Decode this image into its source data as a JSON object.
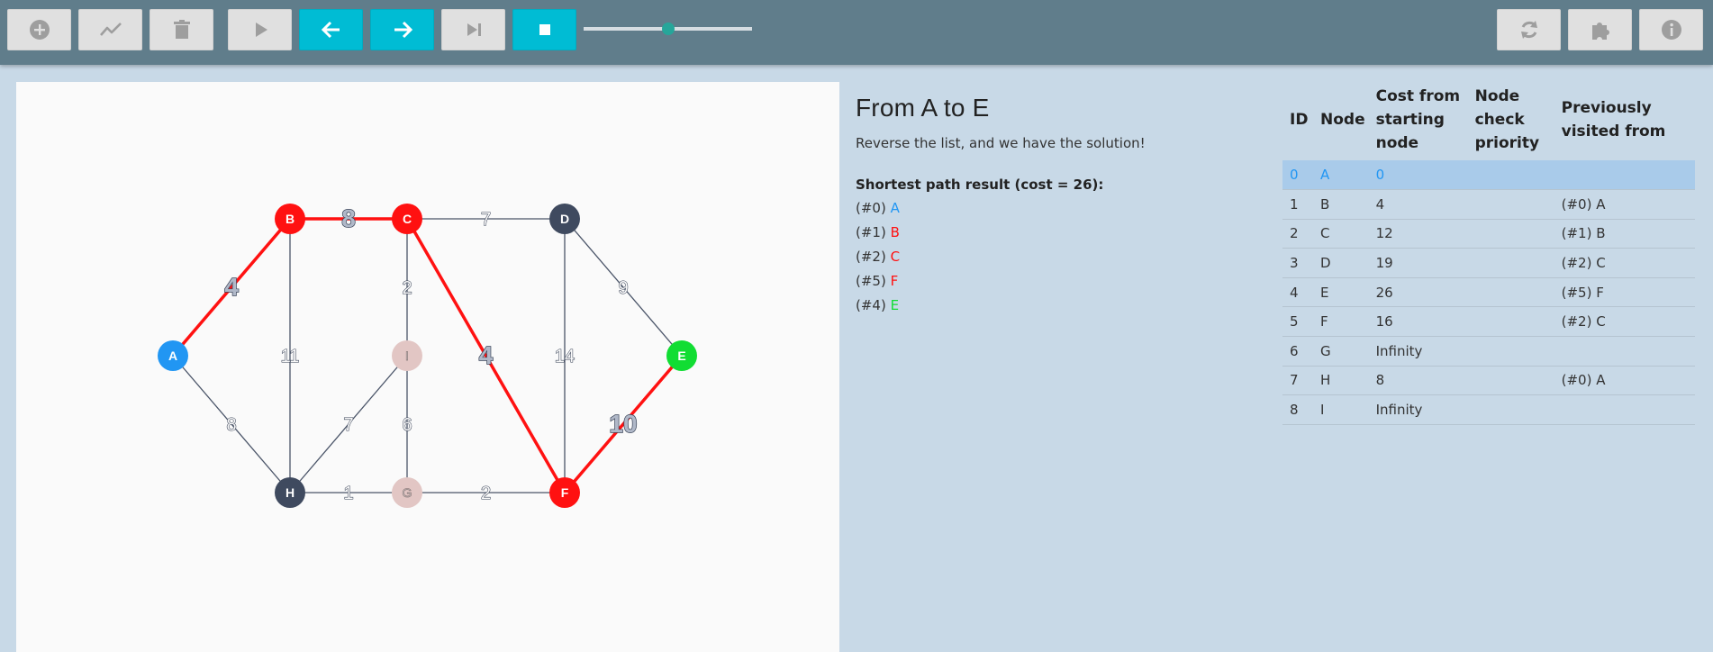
{
  "toolbar": {
    "left_buttons": [
      {
        "name": "add-node-button",
        "icon": "plus-circle-icon",
        "active": false
      },
      {
        "name": "add-edge-button",
        "icon": "chart-line-icon",
        "active": false
      },
      {
        "name": "delete-button",
        "icon": "trash-icon",
        "active": false
      },
      {
        "name": "play-button",
        "icon": "play-icon",
        "active": false
      },
      {
        "name": "step-back-button",
        "icon": "arrow-left-icon",
        "active": true
      },
      {
        "name": "step-forward-button",
        "icon": "arrow-right-icon",
        "active": true
      },
      {
        "name": "skip-to-end-button",
        "icon": "skip-end-icon",
        "active": false
      },
      {
        "name": "stop-button",
        "icon": "stop-icon",
        "active": true
      }
    ],
    "right_buttons": [
      {
        "name": "reset-button",
        "icon": "refresh-icon"
      },
      {
        "name": "plugin-button",
        "icon": "puzzle-icon"
      },
      {
        "name": "info-button",
        "icon": "info-icon"
      }
    ],
    "speed_slider": 0.5,
    "colors": {
      "bar": "#607d8b",
      "button": "#e0e0e0",
      "active": "#00bcd4",
      "thumb": "#26a69a"
    }
  },
  "graph": {
    "nodes": [
      {
        "id": "A",
        "state": "start",
        "color": "#2196f3"
      },
      {
        "id": "B",
        "state": "path",
        "color": "#ff1111"
      },
      {
        "id": "C",
        "state": "path",
        "color": "#ff1111"
      },
      {
        "id": "D",
        "state": "visited",
        "color": "#3f4a5f"
      },
      {
        "id": "E",
        "state": "end",
        "color": "#11dd33"
      },
      {
        "id": "F",
        "state": "path",
        "color": "#ff1111"
      },
      {
        "id": "G",
        "state": "unvisited",
        "color": "#e2c6c4"
      },
      {
        "id": "H",
        "state": "visited",
        "color": "#3f4a5f"
      },
      {
        "id": "I",
        "state": "unvisited",
        "color": "#e2c6c4"
      }
    ],
    "edges": [
      {
        "from": "A",
        "to": "B",
        "weight": "4",
        "on_path": true
      },
      {
        "from": "B",
        "to": "C",
        "weight": "8",
        "on_path": true
      },
      {
        "from": "C",
        "to": "D",
        "weight": "7",
        "on_path": false
      },
      {
        "from": "D",
        "to": "E",
        "weight": "9",
        "on_path": false
      },
      {
        "from": "B",
        "to": "H",
        "weight": "11",
        "on_path": false
      },
      {
        "from": "C",
        "to": "I",
        "weight": "2",
        "on_path": false
      },
      {
        "from": "C",
        "to": "F",
        "weight": "4",
        "on_path": true
      },
      {
        "from": "D",
        "to": "F",
        "weight": "14",
        "on_path": false
      },
      {
        "from": "A",
        "to": "H",
        "weight": "8",
        "on_path": false
      },
      {
        "from": "H",
        "to": "I",
        "weight": "7",
        "on_path": false
      },
      {
        "from": "I",
        "to": "G",
        "weight": "6",
        "on_path": false
      },
      {
        "from": "H",
        "to": "G",
        "weight": "1",
        "on_path": false
      },
      {
        "from": "G",
        "to": "F",
        "weight": "2",
        "on_path": false
      },
      {
        "from": "F",
        "to": "E",
        "weight": "10",
        "on_path": true
      }
    ]
  },
  "info": {
    "title": "From A to E",
    "message": "Reverse the list, and we have the solution!",
    "result_title": "Shortest path result (cost = 26):",
    "path": [
      {
        "prefix": "(#0)",
        "node": "A",
        "color": "#2196f3"
      },
      {
        "prefix": "(#1)",
        "node": "B",
        "color": "#ff1111"
      },
      {
        "prefix": "(#2)",
        "node": "C",
        "color": "#ff1111"
      },
      {
        "prefix": "(#5)",
        "node": "F",
        "color": "#ff1111"
      },
      {
        "prefix": "(#4)",
        "node": "E",
        "color": "#11dd33"
      }
    ]
  },
  "table": {
    "headers": {
      "id": "ID",
      "node": "Node",
      "cost": "Cost from starting node",
      "priority": "Node check priority",
      "previous": "Previously visited from"
    },
    "rows": [
      {
        "id": "0",
        "node": "A",
        "cost": "0",
        "priority": "",
        "previous": "",
        "highlight": true
      },
      {
        "id": "1",
        "node": "B",
        "cost": "4",
        "priority": "",
        "previous": "(#0) A",
        "highlight": false
      },
      {
        "id": "2",
        "node": "C",
        "cost": "12",
        "priority": "",
        "previous": "(#1) B",
        "highlight": false
      },
      {
        "id": "3",
        "node": "D",
        "cost": "19",
        "priority": "",
        "previous": "(#2) C",
        "highlight": false
      },
      {
        "id": "4",
        "node": "E",
        "cost": "26",
        "priority": "",
        "previous": "(#5) F",
        "highlight": false
      },
      {
        "id": "5",
        "node": "F",
        "cost": "16",
        "priority": "",
        "previous": "(#2) C",
        "highlight": false
      },
      {
        "id": "6",
        "node": "G",
        "cost": "Infinity",
        "priority": "",
        "previous": "",
        "highlight": false
      },
      {
        "id": "7",
        "node": "H",
        "cost": "8",
        "priority": "",
        "previous": "(#0) A",
        "highlight": false
      },
      {
        "id": "8",
        "node": "I",
        "cost": "Infinity",
        "priority": "",
        "previous": "",
        "highlight": false
      }
    ]
  }
}
